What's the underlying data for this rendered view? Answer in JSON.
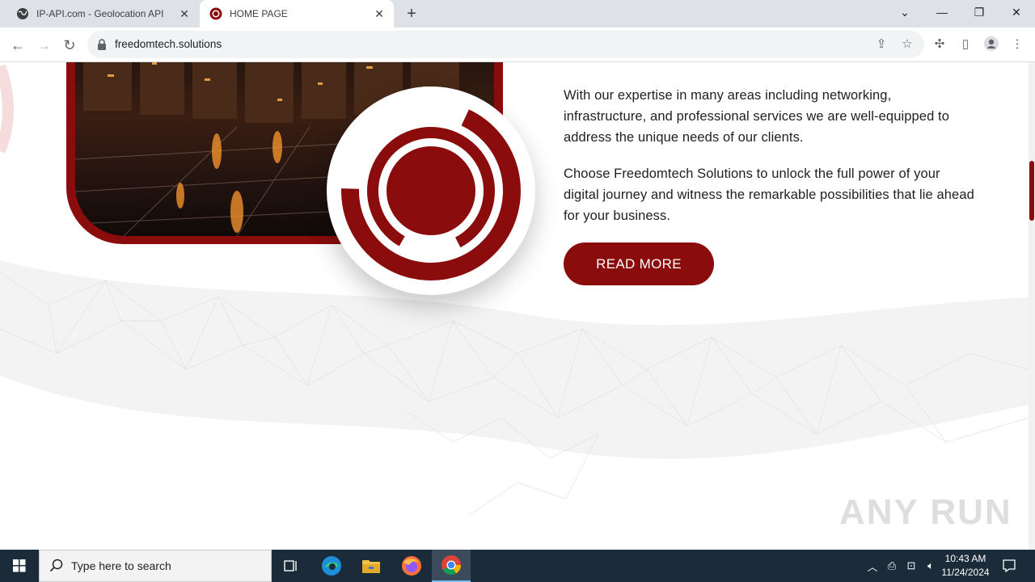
{
  "browser": {
    "tabs": [
      {
        "title": "IP-API.com - Geolocation API",
        "active": false
      },
      {
        "title": "HOME PAGE",
        "active": true
      }
    ],
    "new_tab_icon": "plus-icon",
    "url": "freedomtech.solutions"
  },
  "page": {
    "paragraph_1": "With our expertise in many areas including networking, infrastructure, and professional services we are well-equipped to address the unique needs of our clients.",
    "paragraph_2": "Choose Freedomtech Solutions to unlock the full power of your digital journey and witness the remarkable possibilities that lie ahead for your business.",
    "read_more_label": "READ MORE",
    "watermark": "ANY RUN",
    "colors": {
      "brand": "#8b0c0c",
      "text": "#1f1f1f"
    }
  },
  "taskbar": {
    "search_placeholder": "Type here to search",
    "time": "10:43 AM",
    "date": "11/24/2024"
  }
}
